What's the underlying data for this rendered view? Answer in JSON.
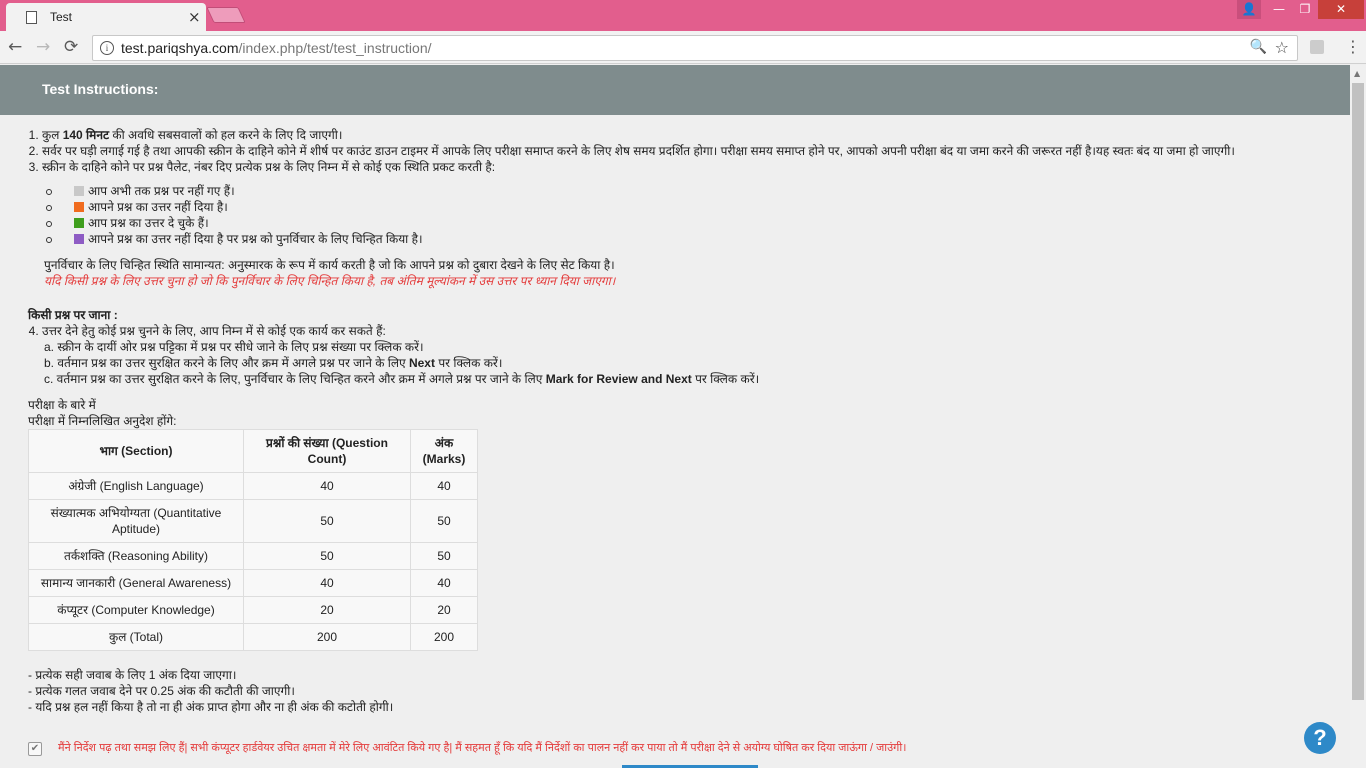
{
  "browser": {
    "tab_title": "Test",
    "tab_close": "×",
    "url_host": "test.pariqshya.com",
    "url_path": "/index.php/test/test_instruction/",
    "back": "←",
    "forward": "→",
    "reload": "⟳",
    "min": "—",
    "max": "❐",
    "close": "✕",
    "user": "👤",
    "zoom": "🔍",
    "star": "☆",
    "menu": "⋮",
    "info": "i"
  },
  "page": {
    "header_title": "Test Instructions:",
    "instr1_pre": "कुल ",
    "instr1_bold": "140 मिनट",
    "instr1_post": " की अवधि सबसवालों को हल करने के लिए दि जाएगी।",
    "instr2": "सर्वर पर घड़ी लगाई गई है तथा आपकी स्क्रीन के दाहिने कोने में शीर्ष पर काउंट डाउन टाइमर में आपके लिए परीक्षा समाप्त करने के लिए शेष समय प्रदर्शित होगा। परीक्षा समय समाप्त होने पर, आपको अपनी परीक्षा बंद या जमा करने की जरूरत नहीं है।यह स्वतः बंद या जमा हो जाएगी।",
    "instr3": "स्क्रीन के दाहिने कोने पर प्रश्न पैलेट, नंबर दिए प्रत्येक प्रश्न के लिए निम्न में से कोई एक स्थिति प्रकट करती है:",
    "legend": [
      {
        "color": "#c8c8c8",
        "text": "आप अभी तक प्रश्न पर नहीं गए हैं।"
      },
      {
        "color": "#f06b1e",
        "text": "आपने प्रश्न का उत्तर नहीं दिया है।"
      },
      {
        "color": "#3f9e1d",
        "text": "आप प्रश्न का उत्तर दे चुके हैं।"
      },
      {
        "color": "#8e5cc4",
        "text": "आपने प्रश्न का उत्तर नहीं दिया है पर प्रश्न को पुनर्विचार के लिए चिन्हित किया है।"
      }
    ],
    "note": "पुनर्विचार के लिए चिन्हित स्थिति सामान्यत: अनुस्मारक के रूप में कार्य करती है जो कि आपने प्रश्न को दुबारा देखने के लिए सेट किया है।",
    "note_red": "यदि किसी प्रश्न के लिए उत्तर चुना हो जो कि पुनर्विचार के लिए चिन्हित किया है, तब अंतिम मूल्यांकन में उस उत्तर पर ध्यान दिया जाएगा।",
    "nav_title": "किसी प्रश्न पर जाना :",
    "instr4": "उत्तर देने हेतु कोई प्रश्न चुनने के लिए, आप निम्न में से कोई एक कार्य कर सकते हैं:",
    "sub_a": "a. स्क्रीन के दायीं ओर प्रश्न पट्टिका में प्रश्न पर सीधे जाने के लिए प्रश्न संख्या पर क्लिक करें।",
    "sub_b_pre": "b. वर्तमान प्रश्न का उत्तर सुरक्षित करने के लिए और क्रम में अगले प्रश्न पर जाने के लिए ",
    "sub_b_bold": "Next",
    "sub_b_post": " पर क्लिक करें।",
    "sub_c_pre": "c. वर्तमान प्रश्न का उत्तर सुरक्षित करने के लिए, पुनर्विचार के लिए चिन्हित करने और क्रम में अगले प्रश्न पर जाने के लिए ",
    "sub_c_bold": "Mark for Review and Next",
    "sub_c_post": " पर क्लिक करें।",
    "about1": "परीक्षा के बारे में",
    "about2": "परीक्षा में निम्नलिखित अनुदेश होंगे:",
    "table": {
      "headers": [
        "भाग (Section)",
        "प्रश्नों की संख्या (Question Count)",
        "अंक (Marks)"
      ],
      "rows": [
        [
          "अंग्रेजी (English Language)",
          "40",
          "40"
        ],
        [
          "संख्यात्मक अभियोग्यता (Quantitative Aptitude)",
          "50",
          "50"
        ],
        [
          "तर्कशक्ति (Reasoning Ability)",
          "50",
          "50"
        ],
        [
          "सामान्य जानकारी (General Awareness)",
          "40",
          "40"
        ],
        [
          "कंप्यूटर (Computer Knowledge)",
          "20",
          "20"
        ],
        [
          "कुल (Total)",
          "200",
          "200"
        ]
      ]
    },
    "rule1": "- प्रत्येक सही जवाब के लिए 1 अंक दिया जाएगा।",
    "rule2": "- प्रत्येक गलत जवाब देने पर 0.25 अंक की कटौती की जाएगी।",
    "rule3": "- यदि प्रश्न हल नहीं किया है तो ना ही अंक प्राप्त होगा और ना ही अंक की कटोती होगी।",
    "agree": "मैंने निर्देश पढ़ तथा समझ लिए हैं| सभी कंप्यूटर हार्डवेयर उचित क्षमता में मेरे लिए आवंटित किये गए है| मैं सहमत हूँ कि यदि मैं निर्देशों का पालन नहीं कर पाया तो मैं परीक्षा देने से अयोग्य घोषित कर दिया जाऊंगा / जाउंगी।",
    "help": "?",
    "check": "✔"
  }
}
